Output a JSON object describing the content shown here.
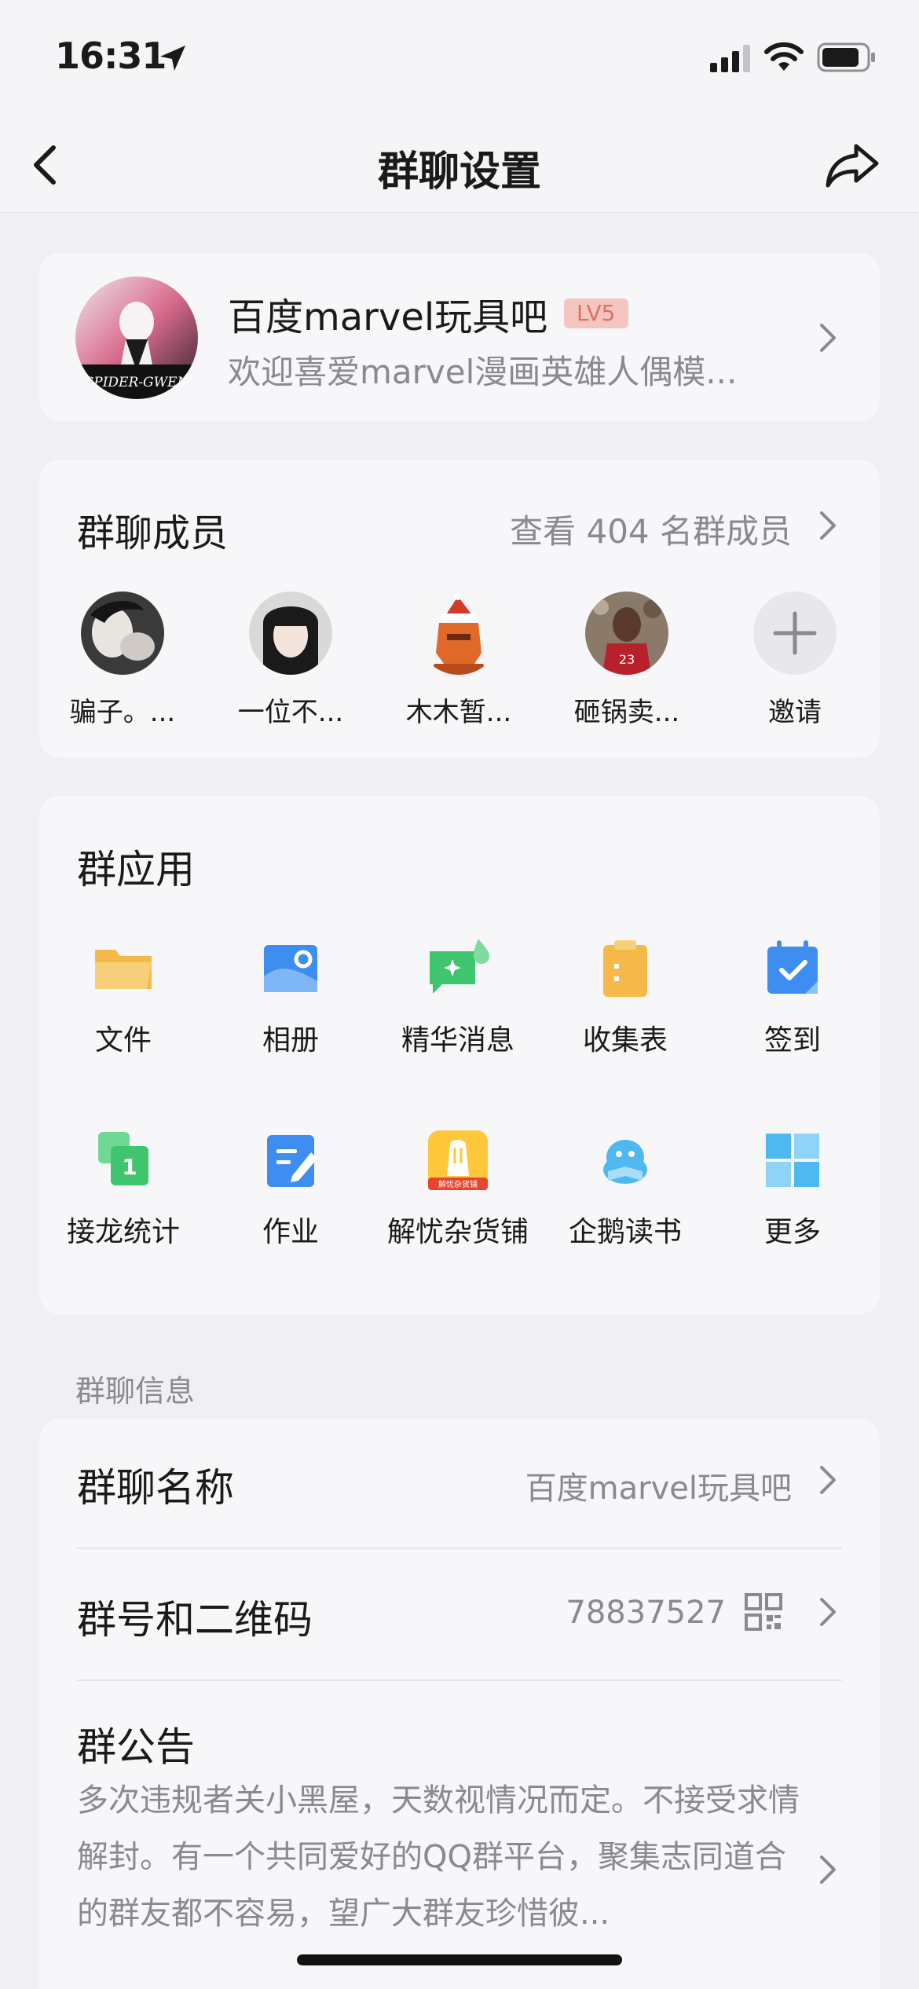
{
  "status": {
    "time": "16:31"
  },
  "nav": {
    "title": "群聊设置"
  },
  "group": {
    "name": "百度marvel玩具吧",
    "level": "LV5",
    "description": "欢迎喜爱marvel漫画英雄人偶模...",
    "avatar_text": "SPIDER-GWEN"
  },
  "members": {
    "title": "群聊成员",
    "view_all": "查看 404 名群成员",
    "list": [
      {
        "name": "骗子。..."
      },
      {
        "name": "一位不..."
      },
      {
        "name": "木木暂..."
      },
      {
        "name": "砸锅卖..."
      }
    ],
    "invite_label": "邀请"
  },
  "apps": {
    "title": "群应用",
    "items": [
      {
        "label": "文件",
        "icon": "folder-icon"
      },
      {
        "label": "相册",
        "icon": "album-icon"
      },
      {
        "label": "精华消息",
        "icon": "essence-message-icon"
      },
      {
        "label": "收集表",
        "icon": "collection-form-icon"
      },
      {
        "label": "签到",
        "icon": "checkin-calendar-icon"
      },
      {
        "label": "接龙统计",
        "icon": "relay-stats-icon"
      },
      {
        "label": "作业",
        "icon": "homework-icon"
      },
      {
        "label": "解忧杂货铺",
        "icon": "grocery-store-icon",
        "badge": "解忧杂货铺"
      },
      {
        "label": "企鹅读书",
        "icon": "penguin-reading-icon"
      },
      {
        "label": "更多",
        "icon": "more-grid-icon"
      }
    ]
  },
  "info": {
    "section_header": "群聊信息",
    "name_label": "群聊名称",
    "name_value": "百度marvel玩具吧",
    "number_label": "群号和二维码",
    "number_value": "78837527",
    "notice_label": "群公告",
    "notice_text": "多次违规者关小黑屋，天数视情况而定。不接受求情解封。有一个共同爱好的QQ群平台，聚集志同道合的群友都不容易，望广大群友珍惜彼..."
  },
  "colors": {
    "background": "#efeff4",
    "card": "#f7f7f9",
    "secondary_text": "#8a8a8e",
    "badge_bg": "#f3c6c1",
    "badge_text": "#e07060",
    "app_blue": "#3d8ef0",
    "app_orange": "#f5b94a",
    "app_green": "#3ec56e"
  }
}
